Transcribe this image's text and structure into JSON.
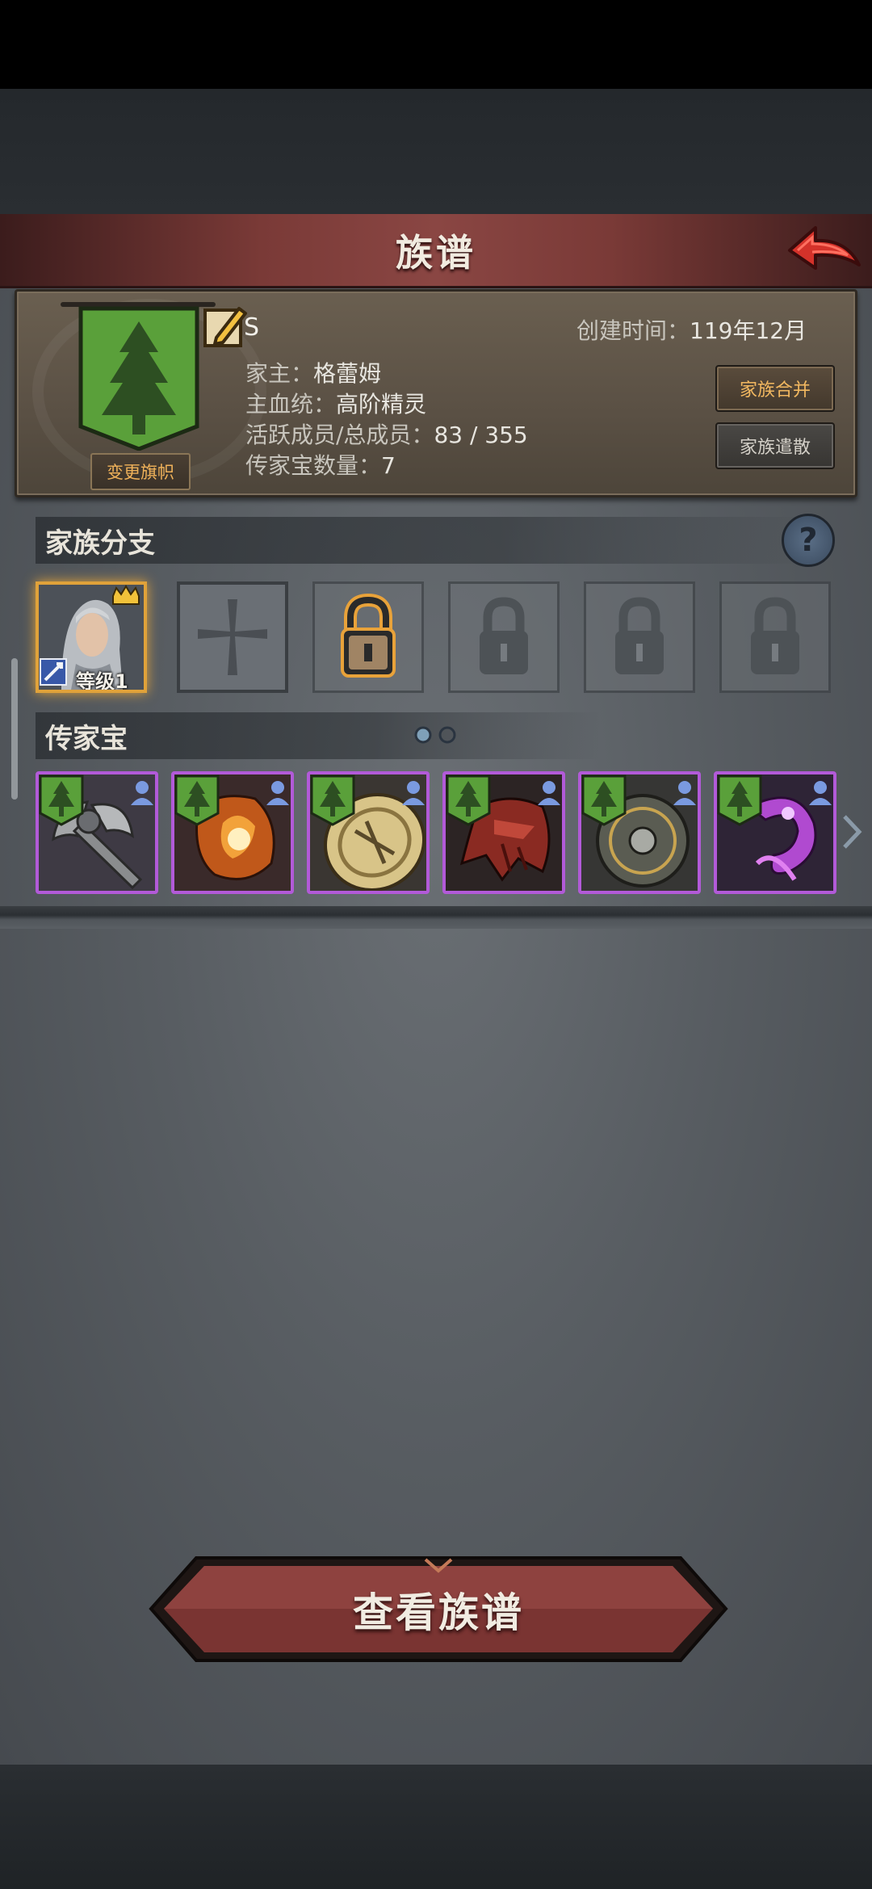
{
  "title": "族谱",
  "family": {
    "name": "S",
    "created_label": "创建时间：",
    "created_value": "119年12月",
    "head_label": "家主：",
    "head_value": "格蕾姆",
    "bloodline_label": "主血统：",
    "bloodline_value": "高阶精灵",
    "members_label": "活跃成员/总成员：",
    "members_value": "83 / 355",
    "heirlooms_label": "传家宝数量：",
    "heirlooms_value": "7",
    "change_banner_label": "变更旗帜",
    "merge_label": "家族合并",
    "disband_label": "家族遣散"
  },
  "branch": {
    "title": "家族分支",
    "help": "?",
    "slots": [
      {
        "state": "member",
        "level_label": "等级1"
      },
      {
        "state": "add"
      },
      {
        "state": "unlockable"
      },
      {
        "state": "locked"
      },
      {
        "state": "locked"
      },
      {
        "state": "locked"
      }
    ]
  },
  "heirloom": {
    "title": "传家宝",
    "items": [
      {
        "icon": "battle-axe-icon"
      },
      {
        "icon": "flame-gauntlet-icon"
      },
      {
        "icon": "golden-shield-icon"
      },
      {
        "icon": "dragon-helmet-icon"
      },
      {
        "icon": "round-shield-icon"
      },
      {
        "icon": "arcane-whip-icon"
      }
    ]
  },
  "bottom_button_label": "查看族谱",
  "colors": {
    "accent_gold": "#f2b860",
    "epic_purple": "#b25ad8",
    "title_bar_red": "#8a4643",
    "banner_green": "#5aa03a"
  }
}
